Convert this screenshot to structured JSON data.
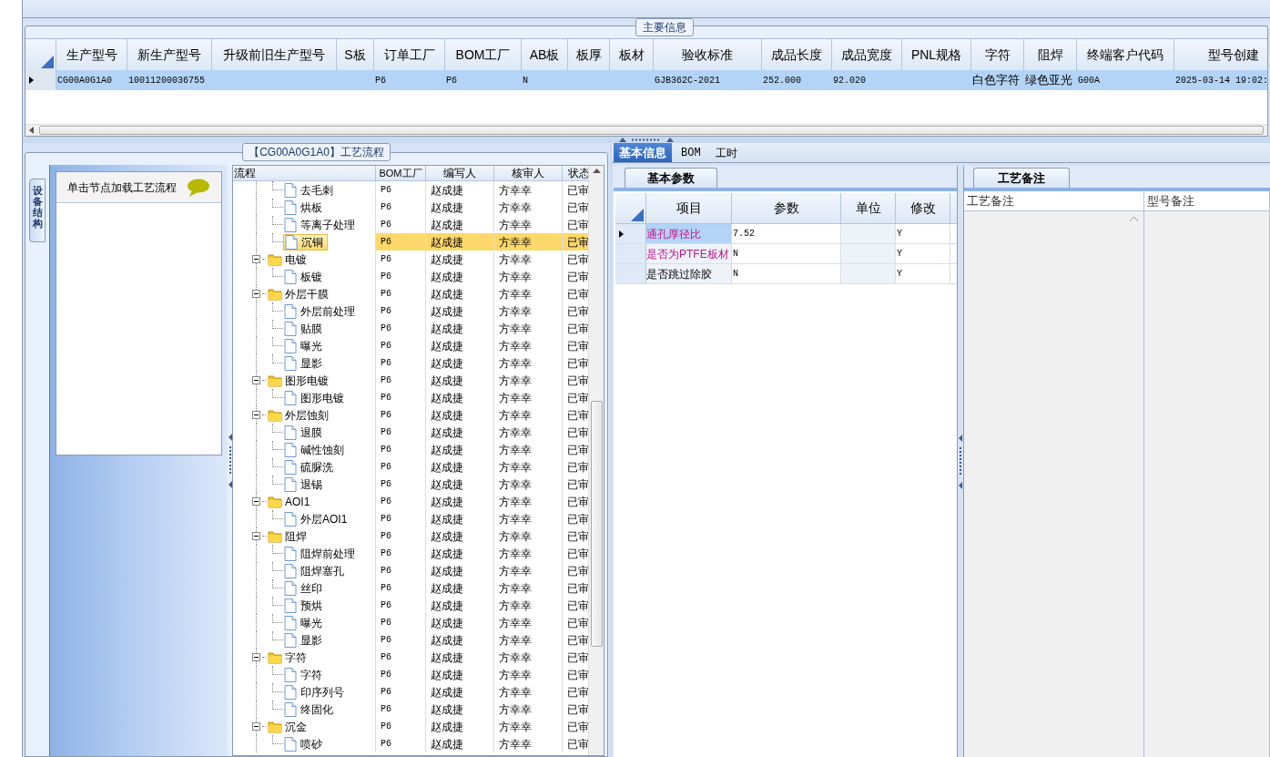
{
  "main_info": {
    "title": "主要信息",
    "columns": [
      "生产型号",
      "新生产型号",
      "升级前旧生产型号",
      "S板",
      "订单工厂",
      "BOM工厂",
      "AB板",
      "板厚",
      "板材",
      "验收标准",
      "成品长度",
      "成品宽度",
      "PNL规格",
      "字符",
      "阻焊",
      "终端客户代码",
      "型号创建"
    ],
    "rows": [
      {
        "selected": true,
        "cells": [
          "CG00A0G1A0",
          "10011200036755",
          "",
          "",
          "P6",
          "P6",
          "N",
          "",
          "",
          "GJB362C-2021",
          "252.000",
          "92.020",
          "",
          "白色字符",
          "绿色亚光",
          "G00A",
          "2025-03-14 19:02:"
        ]
      }
    ]
  },
  "flow_panel": {
    "title": "【CG00A0G1A0】工艺流程",
    "side_tab": "设备结构",
    "hint": "单击节点加载工艺流程",
    "columns": [
      "流程",
      "BOM工厂",
      "编写人",
      "核审人",
      "状态"
    ],
    "nodes": [
      {
        "kind": "leaf",
        "name": "去毛刺",
        "bom": "P6",
        "writer": "赵成捷",
        "reviewer": "方幸幸",
        "status": "已审",
        "selected": false
      },
      {
        "kind": "leaf",
        "name": "烘板",
        "bom": "P6",
        "writer": "赵成捷",
        "reviewer": "方幸幸",
        "status": "已审",
        "selected": false
      },
      {
        "kind": "leaf",
        "name": "等离子处理",
        "bom": "P6",
        "writer": "赵成捷",
        "reviewer": "方幸幸",
        "status": "已审",
        "selected": false
      },
      {
        "kind": "leaf",
        "name": "沉铜",
        "bom": "P6",
        "writer": "赵成捷",
        "reviewer": "方幸幸",
        "status": "已审",
        "selected": true
      },
      {
        "kind": "folder",
        "name": "电镀",
        "bom": "P6",
        "writer": "赵成捷",
        "reviewer": "方幸幸",
        "status": "已审",
        "selected": false,
        "expanded": true,
        "children": [
          {
            "kind": "leaf",
            "name": "板镀",
            "bom": "P6",
            "writer": "赵成捷",
            "reviewer": "方幸幸",
            "status": "已审",
            "selected": false
          }
        ]
      },
      {
        "kind": "folder",
        "name": "外层干膜",
        "bom": "P6",
        "writer": "赵成捷",
        "reviewer": "方幸幸",
        "status": "已审",
        "selected": false,
        "expanded": true,
        "children": [
          {
            "kind": "leaf",
            "name": "外层前处理",
            "bom": "P6",
            "writer": "赵成捷",
            "reviewer": "方幸幸",
            "status": "已审",
            "selected": false
          },
          {
            "kind": "leaf",
            "name": "贴膜",
            "bom": "P6",
            "writer": "赵成捷",
            "reviewer": "方幸幸",
            "status": "已审",
            "selected": false
          },
          {
            "kind": "leaf",
            "name": "曝光",
            "bom": "P6",
            "writer": "赵成捷",
            "reviewer": "方幸幸",
            "status": "已审",
            "selected": false
          },
          {
            "kind": "leaf",
            "name": "显影",
            "bom": "P6",
            "writer": "赵成捷",
            "reviewer": "方幸幸",
            "status": "已审",
            "selected": false
          }
        ]
      },
      {
        "kind": "folder",
        "name": "图形电镀",
        "bom": "P6",
        "writer": "赵成捷",
        "reviewer": "方幸幸",
        "status": "已审",
        "selected": false,
        "expanded": true,
        "children": [
          {
            "kind": "leaf",
            "name": "图形电镀",
            "bom": "P6",
            "writer": "赵成捷",
            "reviewer": "方幸幸",
            "status": "已审",
            "selected": false
          }
        ]
      },
      {
        "kind": "folder",
        "name": "外层蚀刻",
        "bom": "P6",
        "writer": "赵成捷",
        "reviewer": "方幸幸",
        "status": "已审",
        "selected": false,
        "expanded": true,
        "children": [
          {
            "kind": "leaf",
            "name": "退膜",
            "bom": "P6",
            "writer": "赵成捷",
            "reviewer": "方幸幸",
            "status": "已审",
            "selected": false
          },
          {
            "kind": "leaf",
            "name": "碱性蚀刻",
            "bom": "P6",
            "writer": "赵成捷",
            "reviewer": "方幸幸",
            "status": "已审",
            "selected": false
          },
          {
            "kind": "leaf",
            "name": "硫脲洗",
            "bom": "P6",
            "writer": "赵成捷",
            "reviewer": "方幸幸",
            "status": "已审",
            "selected": false
          },
          {
            "kind": "leaf",
            "name": "退锡",
            "bom": "P6",
            "writer": "赵成捷",
            "reviewer": "方幸幸",
            "status": "已审",
            "selected": false
          }
        ]
      },
      {
        "kind": "folder",
        "name": "AOI1",
        "bom": "P6",
        "writer": "赵成捷",
        "reviewer": "方幸幸",
        "status": "已审",
        "selected": false,
        "expanded": true,
        "children": [
          {
            "kind": "leaf",
            "name": "外层AOI1",
            "bom": "P6",
            "writer": "赵成捷",
            "reviewer": "方幸幸",
            "status": "已审",
            "selected": false
          }
        ]
      },
      {
        "kind": "folder",
        "name": "阻焊",
        "bom": "P6",
        "writer": "赵成捷",
        "reviewer": "方幸幸",
        "status": "已审",
        "selected": false,
        "expanded": true,
        "children": [
          {
            "kind": "leaf",
            "name": "阻焊前处理",
            "bom": "P6",
            "writer": "赵成捷",
            "reviewer": "方幸幸",
            "status": "已审",
            "selected": false
          },
          {
            "kind": "leaf",
            "name": "阻焊塞孔",
            "bom": "P6",
            "writer": "赵成捷",
            "reviewer": "方幸幸",
            "status": "已审",
            "selected": false
          },
          {
            "kind": "leaf",
            "name": "丝印",
            "bom": "P6",
            "writer": "赵成捷",
            "reviewer": "方幸幸",
            "status": "已审",
            "selected": false
          },
          {
            "kind": "leaf",
            "name": "预烘",
            "bom": "P6",
            "writer": "赵成捷",
            "reviewer": "方幸幸",
            "status": "已审",
            "selected": false
          },
          {
            "kind": "leaf",
            "name": "曝光",
            "bom": "P6",
            "writer": "赵成捷",
            "reviewer": "方幸幸",
            "status": "已审",
            "selected": false
          },
          {
            "kind": "leaf",
            "name": "显影",
            "bom": "P6",
            "writer": "赵成捷",
            "reviewer": "方幸幸",
            "status": "已审",
            "selected": false
          }
        ]
      },
      {
        "kind": "folder",
        "name": "字符",
        "bom": "P6",
        "writer": "赵成捷",
        "reviewer": "方幸幸",
        "status": "已审",
        "selected": false,
        "expanded": true,
        "children": [
          {
            "kind": "leaf",
            "name": "字符",
            "bom": "P6",
            "writer": "赵成捷",
            "reviewer": "方幸幸",
            "status": "已审",
            "selected": false
          },
          {
            "kind": "leaf",
            "name": "印序列号",
            "bom": "P6",
            "writer": "赵成捷",
            "reviewer": "方幸幸",
            "status": "已审",
            "selected": false
          },
          {
            "kind": "leaf",
            "name": "终固化",
            "bom": "P6",
            "writer": "赵成捷",
            "reviewer": "方幸幸",
            "status": "已审",
            "selected": false
          }
        ]
      },
      {
        "kind": "folder",
        "name": "沉金",
        "bom": "P6",
        "writer": "赵成捷",
        "reviewer": "方幸幸",
        "status": "已审",
        "selected": false,
        "expanded": true,
        "children": [
          {
            "kind": "leaf",
            "name": "喷砂",
            "bom": "P6",
            "writer": "赵成捷",
            "reviewer": "方幸幸",
            "status": "已审",
            "selected": false
          }
        ]
      }
    ]
  },
  "detail_tabs": [
    {
      "label": "基本信息",
      "selected": true
    },
    {
      "label": "BOM",
      "selected": false
    },
    {
      "label": "工时",
      "selected": false
    }
  ],
  "params": {
    "tab": "基本参数",
    "columns": [
      "项目",
      "参数",
      "单位",
      "修改"
    ],
    "rows": [
      {
        "item": "通孔厚径比",
        "value": "7.52",
        "unit": "",
        "modify": "Y",
        "highlighted": true,
        "selected": true
      },
      {
        "item": "是否为PTFE板材",
        "value": "N",
        "unit": "",
        "modify": "Y",
        "highlighted": true,
        "selected": false
      },
      {
        "item": "是否跳过除胶",
        "value": "N",
        "unit": "",
        "modify": "Y",
        "highlighted": false,
        "selected": false
      }
    ]
  },
  "remarks": {
    "tab": "工艺备注",
    "columns": [
      "工艺备注",
      "型号备注"
    ]
  }
}
